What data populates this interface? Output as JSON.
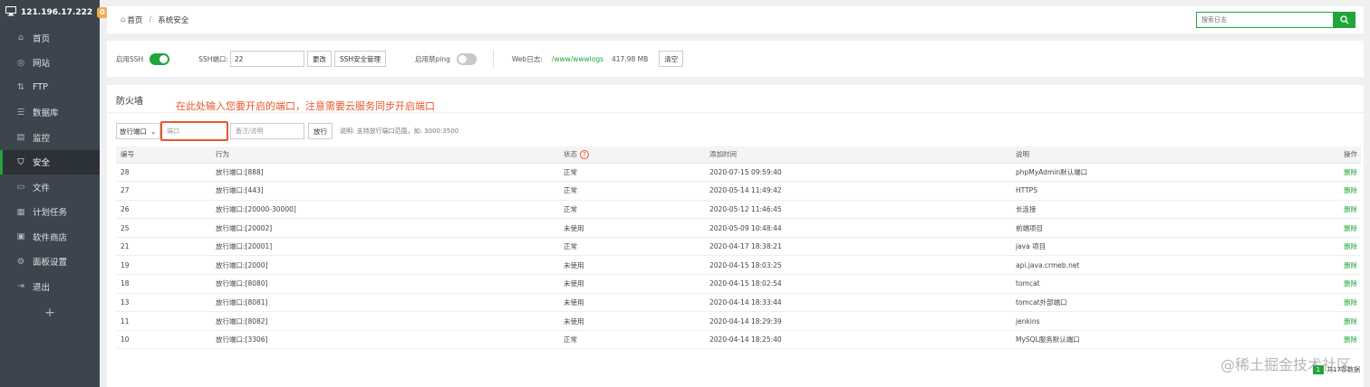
{
  "sidebar": {
    "host": "121.196.17.222",
    "badge": "0",
    "items": [
      {
        "label": "首页",
        "icon": "home-icon"
      },
      {
        "label": "网站",
        "icon": "globe-icon"
      },
      {
        "label": "FTP",
        "icon": "ftp-icon"
      },
      {
        "label": "数据库",
        "icon": "database-icon"
      },
      {
        "label": "监控",
        "icon": "monitor-icon"
      },
      {
        "label": "安全",
        "icon": "shield-icon",
        "active": true
      },
      {
        "label": "文件",
        "icon": "folder-icon"
      },
      {
        "label": "计划任务",
        "icon": "calendar-icon"
      },
      {
        "label": "软件商店",
        "icon": "store-icon"
      },
      {
        "label": "面板设置",
        "icon": "settings-icon"
      },
      {
        "label": "退出",
        "icon": "logout-icon"
      }
    ],
    "plus": "+"
  },
  "header": {
    "breadcrumb_home": "首页",
    "breadcrumb_sep": "/",
    "breadcrumb_current": "系统安全",
    "search_placeholder": "搜索日志"
  },
  "ssh": {
    "enable_label": "启用SSH",
    "enabled": true,
    "port_label": "SSH端口:",
    "port_value": "22",
    "change_btn": "更改",
    "manage_btn": "SSH安全管理",
    "ping_label": "启用禁ping",
    "ping_enabled": false,
    "weblog_label": "Web日志:",
    "weblog_path": "/www/wwwlogs",
    "weblog_size": "417.98 MB",
    "clear_btn": "清空"
  },
  "firewall": {
    "title": "防火墙",
    "annotation": "在此处输入您要开启的端口，注意需要云服务同步开启端口",
    "mode_select": "放行端口",
    "port_placeholder": "端口",
    "note_placeholder": "备注/说明",
    "allow_btn": "放行",
    "hint": "说明: 支持放行端口范围，如: 3000:3500",
    "columns": [
      "编号",
      "行为",
      "状态",
      "添加时间",
      "说明",
      "操作"
    ],
    "help_icon": "?",
    "rows": [
      {
        "id": "28",
        "action": "放行端口:[888]",
        "status": "正常",
        "time": "2020-07-15 09:59:40",
        "note": "phpMyAdmin默认端口",
        "op": "删除"
      },
      {
        "id": "27",
        "action": "放行端口:[443]",
        "status": "正常",
        "time": "2020-05-14 11:49:42",
        "note": "HTTPS",
        "op": "删除"
      },
      {
        "id": "26",
        "action": "放行端口:[20000-30000]",
        "status": "正常",
        "time": "2020-05-12 11:46:45",
        "note": "长连接",
        "op": "删除"
      },
      {
        "id": "25",
        "action": "放行端口:[20002]",
        "status": "未使用",
        "time": "2020-05-09 10:48:44",
        "note": "前端项目",
        "op": "删除"
      },
      {
        "id": "21",
        "action": "放行端口:[20001]",
        "status": "正常",
        "time": "2020-04-17 18:38:21",
        "note": "java 项目",
        "op": "删除"
      },
      {
        "id": "19",
        "action": "放行端口:[2000]",
        "status": "未使用",
        "time": "2020-04-15 18:03:25",
        "note": "api.java.crmeb.net",
        "op": "删除"
      },
      {
        "id": "18",
        "action": "放行端口:[8080]",
        "status": "未使用",
        "time": "2020-04-15 18:02:54",
        "note": "tomcat",
        "op": "删除"
      },
      {
        "id": "13",
        "action": "放行端口:[8081]",
        "status": "未使用",
        "time": "2020-04-14 18:33:44",
        "note": "tomcat外部端口",
        "op": "删除"
      },
      {
        "id": "11",
        "action": "放行端口:[8082]",
        "status": "未使用",
        "time": "2020-04-14 18:29:39",
        "note": "jenkins",
        "op": "删除"
      },
      {
        "id": "10",
        "action": "放行端口:[3306]",
        "status": "正常",
        "time": "2020-04-14 18:25:40",
        "note": "MySQL服务默认端口",
        "op": "删除"
      }
    ],
    "pager_current": "1",
    "pager_total": "共17条数据"
  },
  "watermark": "@稀土掘金技术社区",
  "colors": {
    "accent": "#20a53a",
    "sidebar": "#3c444d",
    "annotation": "#e8572b"
  }
}
